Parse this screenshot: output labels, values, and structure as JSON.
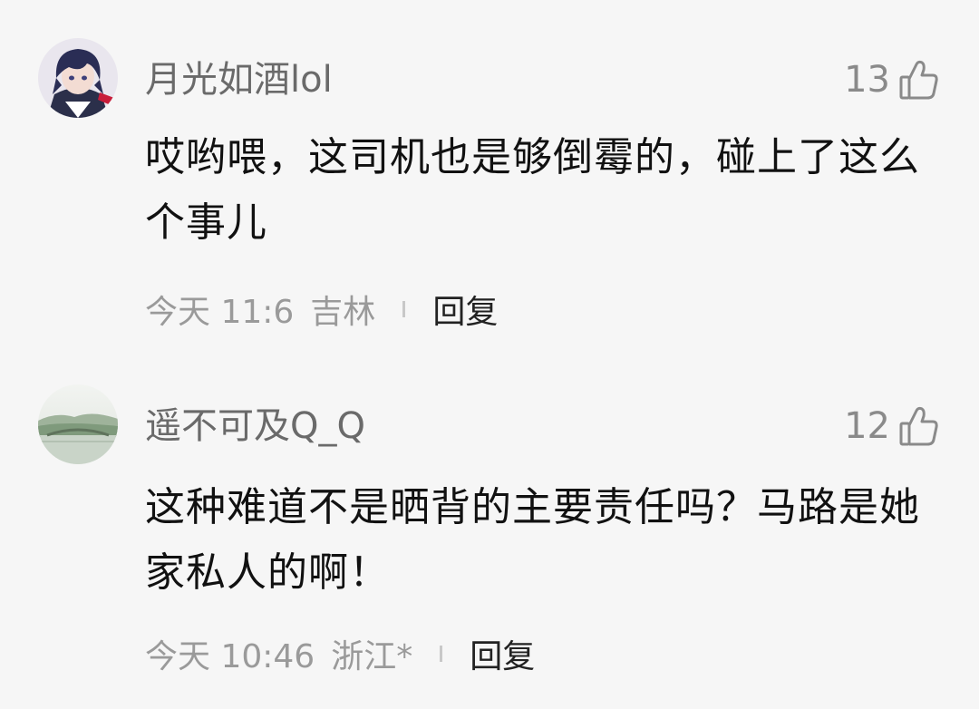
{
  "comments": [
    {
      "username": "月光如酒lol",
      "likes": "13",
      "text": "哎哟喂，这司机也是够倒霉的，碰上了这么个事儿",
      "time": "今天 11:6",
      "location": "吉林",
      "reply_label": "回复",
      "avatar_icon": "anime-character-avatar",
      "like_icon": "thumbs-up-outline-icon"
    },
    {
      "username": "遥不可及Q_Q",
      "likes": "12",
      "text": "这种难道不是晒背的主要责任吗？马路是她家私人的啊！",
      "time": "今天 10:46",
      "location": "浙江*",
      "reply_label": "回复",
      "avatar_icon": "landscape-photo-avatar",
      "like_icon": "thumbs-up-outline-icon"
    }
  ],
  "colors": {
    "background": "#f6f6f6",
    "username": "#6a6a6a",
    "body_text": "#111111",
    "meta_text": "#9a9a9a",
    "reply_text": "#222222"
  }
}
